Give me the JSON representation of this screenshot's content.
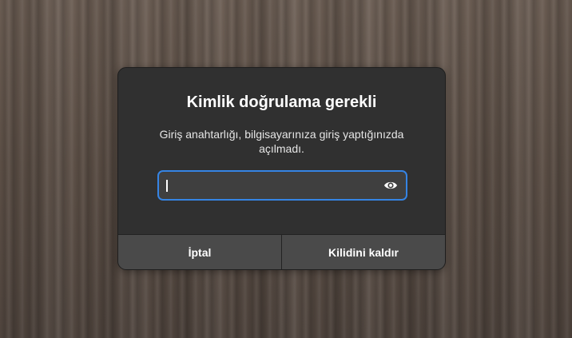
{
  "dialog": {
    "title": "Kimlik doğrulama gerekli",
    "description": "Giriş anahtarlığı, bilgisayarınıza giriş yaptığınızda açılmadı.",
    "password": {
      "value": "",
      "reveal_icon": "eye-icon"
    },
    "buttons": {
      "cancel_label": "İptal",
      "unlock_label": "Kilidini kaldır"
    }
  },
  "colors": {
    "dialog_background": "#303030",
    "button_background": "#4a4a4a",
    "focus_accent": "#3584e4",
    "text": "#ffffff"
  }
}
